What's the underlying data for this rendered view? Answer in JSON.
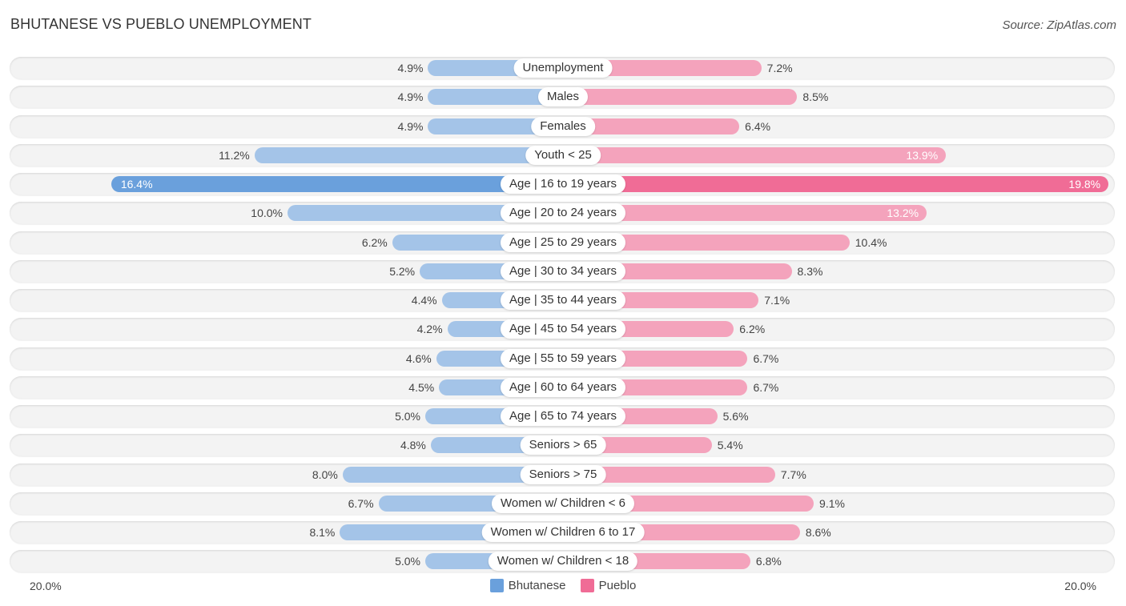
{
  "header": {
    "title": "BHUTANESE VS PUEBLO UNEMPLOYMENT",
    "source": "Source: ZipAtlas.com"
  },
  "colors": {
    "bhutanese": "#a4c4e8",
    "bhutanese_strong": "#6aa0dc",
    "pueblo": "#f4a3bc",
    "pueblo_strong": "#f06c96"
  },
  "chart_data": {
    "type": "bar",
    "orientation": "horizontal-diverging",
    "title": "BHUTANESE VS PUEBLO UNEMPLOYMENT",
    "categories": [
      "Unemployment",
      "Males",
      "Females",
      "Youth < 25",
      "Age | 16 to 19 years",
      "Age | 20 to 24 years",
      "Age | 25 to 29 years",
      "Age | 30 to 34 years",
      "Age | 35 to 44 years",
      "Age | 45 to 54 years",
      "Age | 55 to 59 years",
      "Age | 60 to 64 years",
      "Age | 65 to 74 years",
      "Seniors > 65",
      "Seniors > 75",
      "Women w/ Children < 6",
      "Women w/ Children 6 to 17",
      "Women w/ Children < 18"
    ],
    "series": [
      {
        "name": "Bhutanese",
        "side": "left",
        "values": [
          4.9,
          4.9,
          4.9,
          11.2,
          16.4,
          10.0,
          6.2,
          5.2,
          4.4,
          4.2,
          4.6,
          4.5,
          5.0,
          4.8,
          8.0,
          6.7,
          8.1,
          5.0
        ],
        "labels": [
          "4.9%",
          "4.9%",
          "4.9%",
          "11.2%",
          "16.4%",
          "10.0%",
          "6.2%",
          "5.2%",
          "4.4%",
          "4.2%",
          "4.6%",
          "4.5%",
          "5.0%",
          "4.8%",
          "8.0%",
          "6.7%",
          "8.1%",
          "5.0%"
        ]
      },
      {
        "name": "Pueblo",
        "side": "right",
        "values": [
          7.2,
          8.5,
          6.4,
          13.9,
          19.8,
          13.2,
          10.4,
          8.3,
          7.1,
          6.2,
          6.7,
          6.7,
          5.6,
          5.4,
          7.7,
          9.1,
          8.6,
          6.8
        ],
        "labels": [
          "7.2%",
          "8.5%",
          "6.4%",
          "13.9%",
          "19.8%",
          "13.2%",
          "10.4%",
          "8.3%",
          "7.1%",
          "6.2%",
          "6.7%",
          "6.7%",
          "5.6%",
          "5.4%",
          "7.7%",
          "9.1%",
          "8.6%",
          "6.8%"
        ]
      }
    ],
    "xlim": [
      -20,
      20
    ],
    "axis_labels": {
      "left": "20.0%",
      "right": "20.0%"
    },
    "legend": {
      "position": "bottom-center",
      "entries": [
        "Bhutanese",
        "Pueblo"
      ]
    },
    "grid": false
  }
}
